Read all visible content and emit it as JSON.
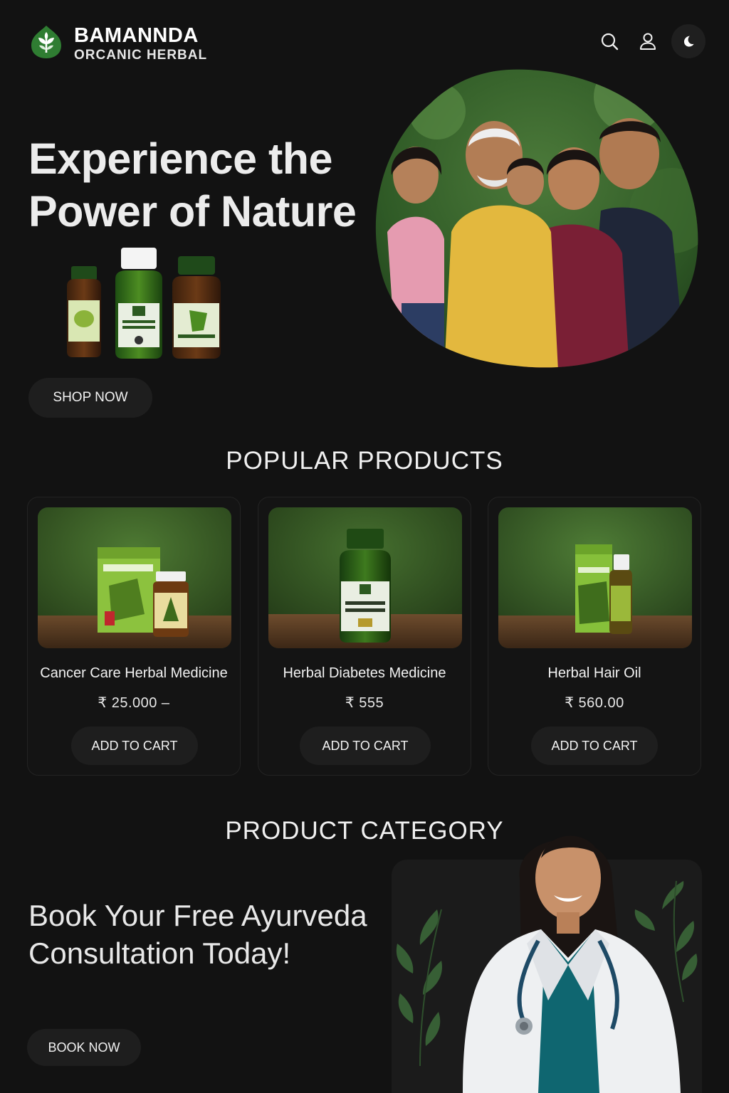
{
  "brand": {
    "name": "BAMANNDA",
    "subtitle": "ORCANIC HERBAL",
    "logo_icon": "leaf-logo-icon",
    "accent": "#2f7d32"
  },
  "header": {
    "icons": [
      "search-icon",
      "user-icon",
      "moon-icon"
    ]
  },
  "hero": {
    "title": "Experience the Power of Nature",
    "cta_label": "SHOP NOW"
  },
  "popular": {
    "title": "POPULAR PRODUCTS",
    "products": [
      {
        "name": "Cancer Care Herbal Medicine",
        "price": "₹ 25.000 –",
        "button": "ADD TO CART"
      },
      {
        "name": "Herbal Diabetes Medicine",
        "price": "₹ 555",
        "button": "ADD TO CART"
      },
      {
        "name": "Herbal Hair Oil",
        "price": "₹ 560.00",
        "button": "ADD TO CART"
      }
    ]
  },
  "category": {
    "title": "PRODUCT CATEGORY"
  },
  "consultation": {
    "title": "Book Your Free Ayurveda Consultation Today!",
    "cta_label": "BOOK NOW"
  },
  "colors": {
    "background": "#121212",
    "card": "#141414",
    "button": "#1e1e1e",
    "text": "#ececec",
    "herbal_green": "#6aa52f"
  }
}
